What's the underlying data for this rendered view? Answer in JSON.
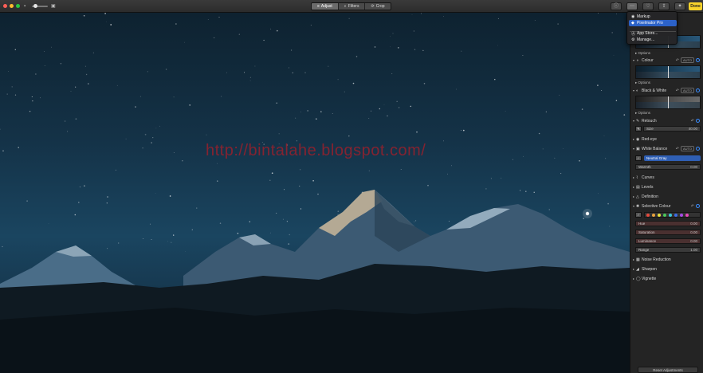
{
  "toolbar": {
    "tabs": [
      {
        "label": "Adjust",
        "icon": "sliders-icon",
        "glyph": "≡"
      },
      {
        "label": "Filters",
        "icon": "filters-icon",
        "glyph": "◐"
      },
      {
        "label": "Crop",
        "icon": "crop-icon",
        "glyph": "⟳"
      }
    ],
    "done_label": "Done",
    "right_icons": [
      {
        "name": "info-icon",
        "glyph": "ⓘ"
      },
      {
        "name": "extensions-icon",
        "glyph": "⋯"
      },
      {
        "name": "favorite-icon",
        "glyph": "♡"
      },
      {
        "name": "share-icon",
        "glyph": "⇪"
      },
      {
        "name": "magic-wand-icon",
        "glyph": "✦"
      }
    ]
  },
  "watermark": "http://bintalahe.blogspot.com/",
  "menu": {
    "items": [
      {
        "label": "Markup",
        "icon": "markup-icon",
        "glyph": "◉"
      },
      {
        "label": "Pixelmator Pro",
        "icon": "pixelmator-icon",
        "glyph": "◆"
      },
      {
        "label": "App Store...",
        "icon": "app-store-icon",
        "glyph": "Ⓐ"
      },
      {
        "label": "Manage...",
        "icon": "manage-icon",
        "glyph": "⚙"
      }
    ]
  },
  "sidebar": {
    "options_label": "Options",
    "auto_label": "AUTO",
    "colour": {
      "label": "Colour"
    },
    "bw": {
      "label": "Black & White"
    },
    "retouch": {
      "label": "Retouch",
      "size_label": "Size",
      "size_value": "40.00"
    },
    "red_eye": {
      "label": "Red-eye"
    },
    "white_balance": {
      "label": "White Balance",
      "mode": "Neutral Gray",
      "warmth_label": "Warmth",
      "warmth_value": "0.00"
    },
    "curves": {
      "label": "Curves"
    },
    "levels": {
      "label": "Levels"
    },
    "definition": {
      "label": "Definition"
    },
    "selective_colour": {
      "label": "Selective Colour",
      "rows": [
        {
          "label": "Hue",
          "value": "0.00"
        },
        {
          "label": "Saturation",
          "value": "0.00"
        },
        {
          "label": "Luminance",
          "value": "0.00"
        },
        {
          "label": "Range",
          "value": "1.00"
        }
      ],
      "swatches": [
        "#e84a3c",
        "#e8a23c",
        "#e8e03c",
        "#4ac85a",
        "#3cc8d8",
        "#3c6ce8",
        "#a84ae8",
        "#e84ab8"
      ]
    },
    "noise_reduction": {
      "label": "Noise Reduction"
    },
    "sharpen": {
      "label": "Sharpen"
    },
    "vignette": {
      "label": "Vignette"
    },
    "reset_label": "Reset Adjustments"
  },
  "colors": {
    "accent": "#2c62c8",
    "done": "#f7d22b"
  }
}
